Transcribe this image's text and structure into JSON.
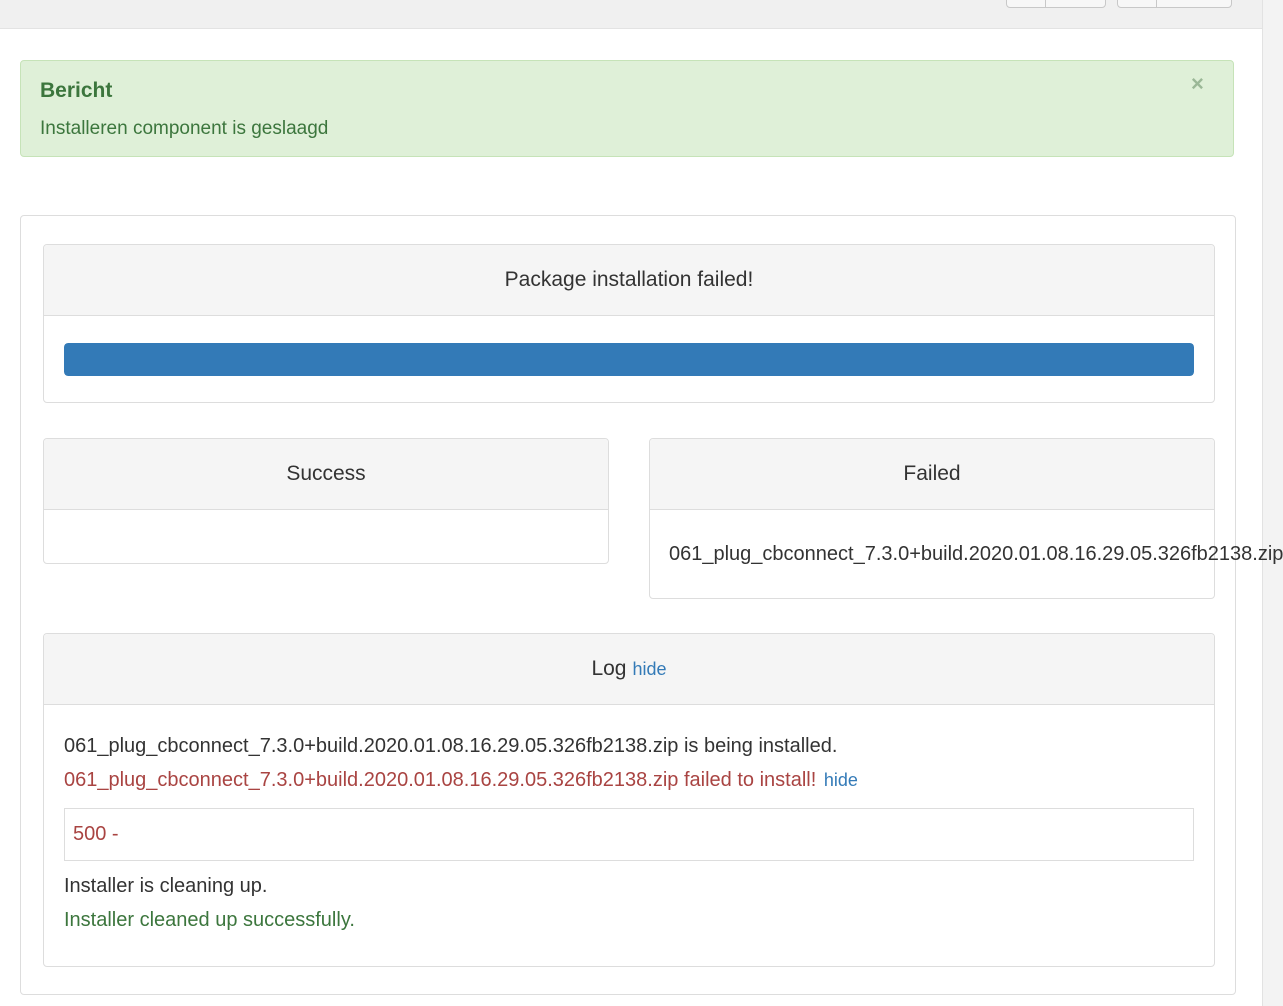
{
  "alert": {
    "heading": "Bericht",
    "message": "Installeren component is geslaagd",
    "close": "×"
  },
  "package_panel": {
    "title": "Package installation failed!",
    "progress": 1.0
  },
  "success_panel": {
    "title": "Success"
  },
  "failed_panel": {
    "title": "Failed",
    "file": "061_plug_cbconnect_7.3.0+build.2020.01.08.16.29.05.326fb2138.zip"
  },
  "log_panel": {
    "title": "Log",
    "hide_link": "hide",
    "line1": "061_plug_cbconnect_7.3.0+build.2020.01.08.16.29.05.326fb2138.zip is being installed.",
    "line2": "061_plug_cbconnect_7.3.0+build.2020.01.08.16.29.05.326fb2138.zip failed to install!",
    "line2_hide": "hide",
    "error_code": "500 -",
    "line3": "Installer is cleaning up.",
    "line4": "Installer cleaned up successfully."
  },
  "colors": {
    "alert_bg": "#dff0d8",
    "alert_text": "#3c763d",
    "progress": "#337ab7",
    "error": "#a94442",
    "link": "#337ab7"
  }
}
